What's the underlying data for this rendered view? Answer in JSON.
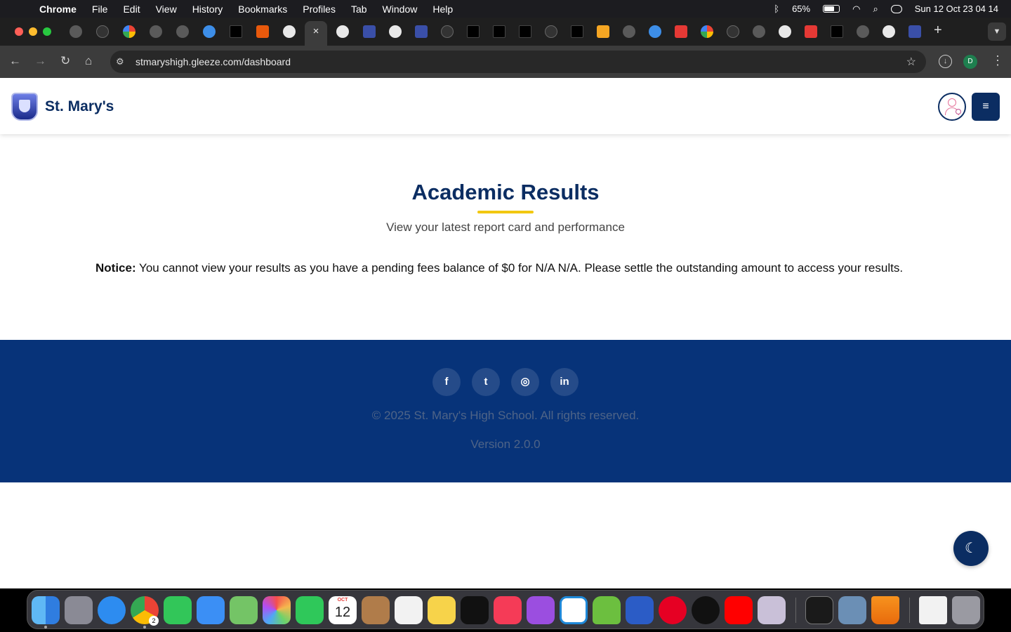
{
  "menubar": {
    "app": "Chrome",
    "items": [
      "File",
      "Edit",
      "View",
      "History",
      "Bookmarks",
      "Profiles",
      "Tab",
      "Window",
      "Help"
    ],
    "battery": "65%",
    "clock": "Sun 12 Oct  23 04 14"
  },
  "browser": {
    "url": "stmaryshigh.gleeze.com/dashboard",
    "active_tab_close": "×",
    "new_tab": "+",
    "profile_initial": "D"
  },
  "site": {
    "brand": "St. Mary's",
    "menu_icon": "≡"
  },
  "main": {
    "title": "Academic Results",
    "subtitle": "View your latest report card and performance",
    "notice_label": "Notice:",
    "notice_text": " You cannot view your results as you have a pending fees balance of $0 for N/A N/A. Please settle the outstanding amount to access your results."
  },
  "footer": {
    "social": [
      {
        "name": "facebook",
        "glyph": "f"
      },
      {
        "name": "twitter",
        "glyph": "t"
      },
      {
        "name": "instagram",
        "glyph": "◎"
      },
      {
        "name": "linkedin",
        "glyph": "in"
      }
    ],
    "copyright": "© 2025 St. Mary's High School. All rights reserved.",
    "version": "Version 2.0.0"
  },
  "theme_toggle_icon": "☾",
  "dock": {
    "calendar_month": "OCT",
    "calendar_day": "12",
    "chrome_badge": "2"
  },
  "colors": {
    "primary": "#0b2d62",
    "accent": "#f2c811",
    "footer_bg": "#073379"
  }
}
